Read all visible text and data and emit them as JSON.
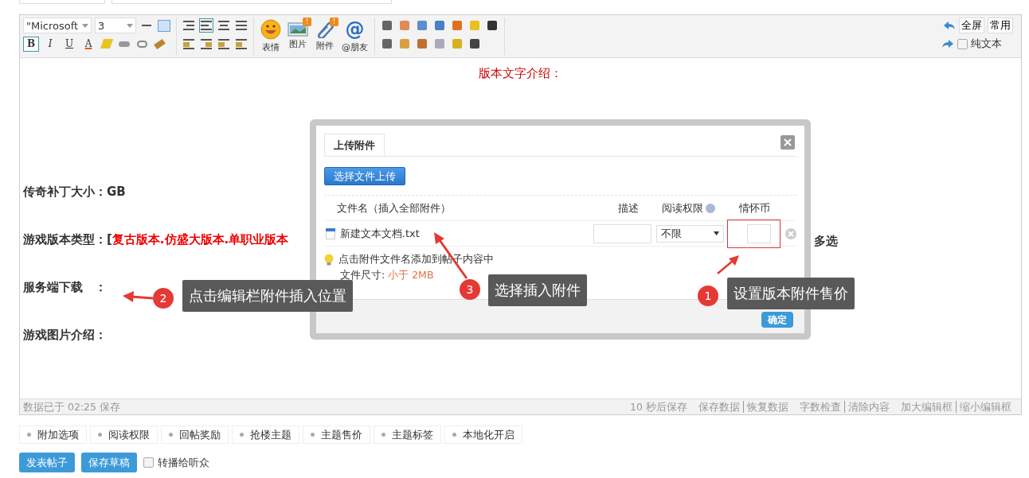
{
  "toolbar": {
    "font": "\"Microsoft",
    "size": "3",
    "format_buttons": [
      {
        "label": "B",
        "selected": true
      },
      {
        "label": "I",
        "selected": false
      },
      {
        "label": "U",
        "selected": false
      },
      {
        "label": "A",
        "selected": false
      }
    ],
    "align_buttons": [
      {
        "selected": false
      },
      {
        "selected": true
      },
      {
        "selected": false
      },
      {
        "selected": false
      }
    ],
    "big_buttons": [
      {
        "kind": "emoji",
        "label": "表情"
      },
      {
        "kind": "image",
        "label": "图片",
        "badge": "!"
      },
      {
        "kind": "attach",
        "label": "附件",
        "badge": "!"
      },
      {
        "kind": "at",
        "glyph": "@",
        "label": "@朋友"
      }
    ],
    "right_buttons": [
      "全屏",
      "常用"
    ],
    "plain_text": {
      "label": "纯文本",
      "checked": false
    }
  },
  "editor": {
    "heading": "版本文字介绍：",
    "lines": [
      {
        "label": "传奇补丁大小：",
        "value": "GB"
      },
      {
        "label": "游戏版本类型：",
        "value": "[",
        "extra": "复古版本.仿盛大版本.单职业版本",
        "tail": "多选"
      },
      {
        "label": "服务端下载　："
      },
      {
        "label": "游戏图片介绍："
      }
    ]
  },
  "dialog": {
    "tab": "上传附件",
    "upload_button": "选择文件上传",
    "columns": [
      "文件名（插入全部附件）",
      "描述",
      "阅读权限",
      "情怀币"
    ],
    "files": [
      {
        "name": "新建文本文档.txt",
        "permission": "不限"
      }
    ],
    "hint": "点击附件文件名添加到帖子内容中",
    "size_label": "文件尺寸: ",
    "size_value": "小于 2MB",
    "confirm": "确定"
  },
  "callouts": [
    {
      "number": "2",
      "text": "点击编辑栏附件插入位置"
    },
    {
      "number": "3",
      "text": "选择插入附件"
    },
    {
      "number": "1",
      "text": "设置版本附件售价"
    }
  ],
  "status_bar": {
    "saved": "数据已于 02:25 保存",
    "autosave": "10 秒后保存",
    "link_groups": [
      [
        "保存数据",
        "恢复数据"
      ],
      [
        "字数检查",
        "清除内容"
      ],
      [
        "加大编辑框",
        "缩小编辑框"
      ]
    ]
  },
  "options": [
    "附加选项",
    "阅读权限",
    "回帖奖励",
    "抢楼主题",
    "主题售价",
    "主题标签",
    "本地化开启"
  ],
  "actions": {
    "buttons": [
      "发表帖子",
      "保存草稿"
    ],
    "broadcast": {
      "label": "转播给听众",
      "checked": false
    }
  }
}
